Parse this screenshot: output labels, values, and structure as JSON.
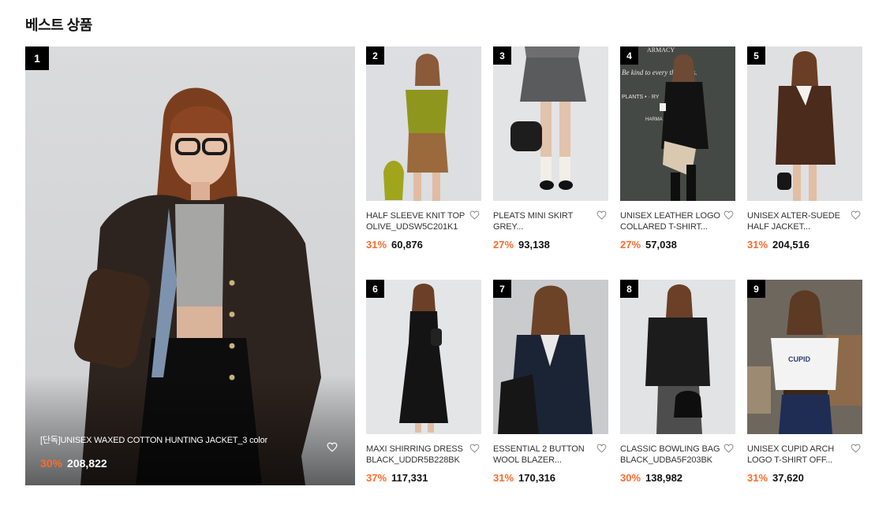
{
  "section": {
    "title": "베스트 상품"
  },
  "featured": {
    "rank": "1",
    "name": "[단독]UNISEX WAXED COTTON HUNTING JACKET_3 color",
    "discount": "30%",
    "price": "208,822",
    "icon": "heart-outline-icon"
  },
  "products": [
    {
      "rank": "2",
      "name": "HALF SLEEVE KNIT TOP OLIVE_UDSW5C201K1",
      "discount": "31%",
      "price": "60,876"
    },
    {
      "rank": "3",
      "name": "PLEATS MINI SKIRT GREY...",
      "discount": "27%",
      "price": "93,138"
    },
    {
      "rank": "4",
      "name": "UNISEX LEATHER LOGO COLLARED T-SHIRT...",
      "discount": "27%",
      "price": "57,038"
    },
    {
      "rank": "5",
      "name": "UNISEX ALTER-SUEDE HALF JACKET...",
      "discount": "31%",
      "price": "204,516"
    },
    {
      "rank": "6",
      "name": "MAXI SHIRRING DRESS BLACK_UDDR5B228BK",
      "discount": "37%",
      "price": "117,331"
    },
    {
      "rank": "7",
      "name": "ESSENTIAL 2 BUTTON WOOL BLAZER...",
      "discount": "31%",
      "price": "170,316"
    },
    {
      "rank": "8",
      "name": "CLASSIC BOWLING BAG BLACK_UDBA5F203BK",
      "discount": "30%",
      "price": "138,982"
    },
    {
      "rank": "9",
      "name": "UNISEX CUPID ARCH LOGO T-SHIRT OFF...",
      "discount": "31%",
      "price": "37,620"
    }
  ],
  "photo_text": {
    "store_sign_top": "ARMACY",
    "store_sign_line": "Be kind to every   that lives.",
    "store_sign_bottom": "PLANTS  •   ·   RY",
    "store_sign_small": "HARMA        SE"
  },
  "colors": {
    "accent_discount": "#ff6a2b",
    "rank_badge": "#000000"
  }
}
